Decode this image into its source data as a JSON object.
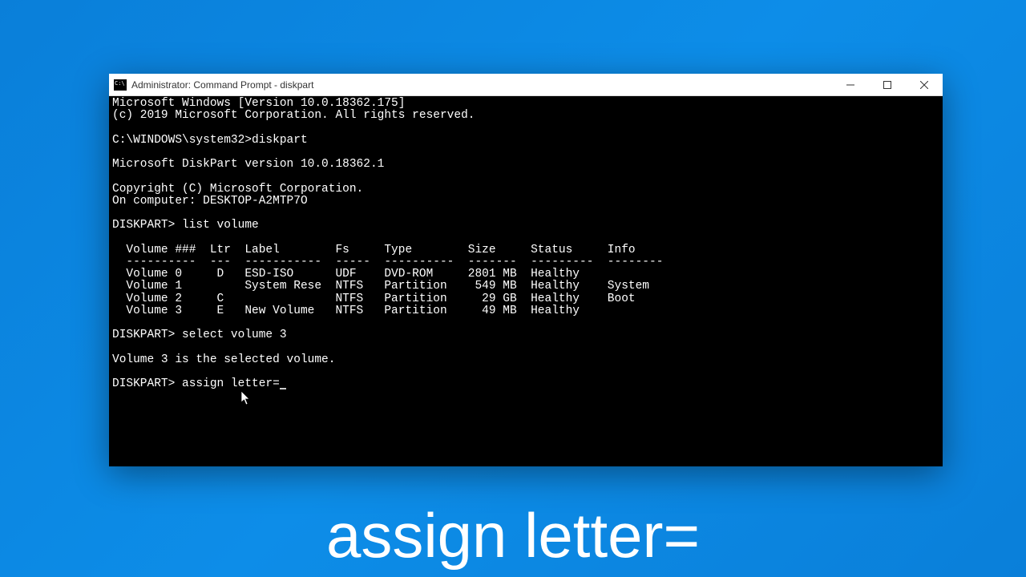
{
  "window": {
    "title": "Administrator: Command Prompt - diskpart"
  },
  "terminal": {
    "line1": "Microsoft Windows [Version 10.0.18362.175]",
    "line2": "(c) 2019 Microsoft Corporation. All rights reserved.",
    "blank1": "",
    "prompt1": "C:\\WINDOWS\\system32>diskpart",
    "blank2": "",
    "dp_version": "Microsoft DiskPart version 10.0.18362.1",
    "blank3": "",
    "copyright": "Copyright (C) Microsoft Corporation.",
    "computer": "On computer: DESKTOP-A2MTP7O",
    "blank4": "",
    "cmd_list": "DISKPART> list volume",
    "blank5": "",
    "header": "  Volume ###  Ltr  Label        Fs     Type        Size     Status     Info",
    "divider": "  ----------  ---  -----------  -----  ----------  -------  ---------  --------",
    "row0": "  Volume 0     D   ESD-ISO      UDF    DVD-ROM     2801 MB  Healthy",
    "row1": "  Volume 1         System Rese  NTFS   Partition    549 MB  Healthy    System",
    "row2": "  Volume 2     C                NTFS   Partition     29 GB  Healthy    Boot",
    "row3": "  Volume 3     E   New Volume   NTFS   Partition     49 MB  Healthy",
    "blank6": "",
    "cmd_select": "DISKPART> select volume 3",
    "blank7": "",
    "selected_msg": "Volume 3 is the selected volume.",
    "blank8": "",
    "cmd_assign": "DISKPART> assign letter="
  },
  "caption": "assign letter="
}
